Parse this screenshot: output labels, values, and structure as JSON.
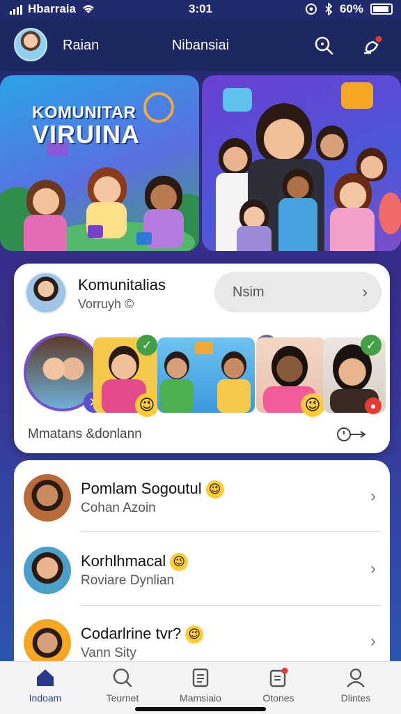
{
  "status_bar": {
    "carrier": "Hbarraia",
    "time": "3:01",
    "battery": "60%"
  },
  "header": {
    "left_label": "Raian",
    "title": "Nibansiai"
  },
  "banner": {
    "line1": "KOMUNITAR",
    "line2": "VIRUINA"
  },
  "community_card": {
    "title": "Komunitalias",
    "subtitle": "Vorruyh ©",
    "pill_label": "Nsim",
    "footer_label": "Mmatans &donlann"
  },
  "list": {
    "items": [
      {
        "title": "Pomlam Sogoutul",
        "subtitle": "Cohan Azoin",
        "emoji": "😉"
      },
      {
        "title": "Korhlhmacal",
        "subtitle": "Roviare Dynlian",
        "emoji": "😉"
      },
      {
        "title": "Codarlrine tvr?",
        "subtitle": "Vann Sity",
        "emoji": "😉"
      }
    ]
  },
  "nav": {
    "items": [
      {
        "label": "Indoam",
        "icon": "home-icon"
      },
      {
        "label": "Teurnet",
        "icon": "search-icon"
      },
      {
        "label": "Mamsiaio",
        "icon": "document-icon"
      },
      {
        "label": "Otones",
        "icon": "edit-doc-icon"
      },
      {
        "label": "Dlintes",
        "icon": "user-icon"
      }
    ]
  },
  "colors": {
    "header_bg": "#1d2760",
    "accent": "#2a3a8a",
    "notification": "#e53935",
    "check": "#43a047"
  }
}
